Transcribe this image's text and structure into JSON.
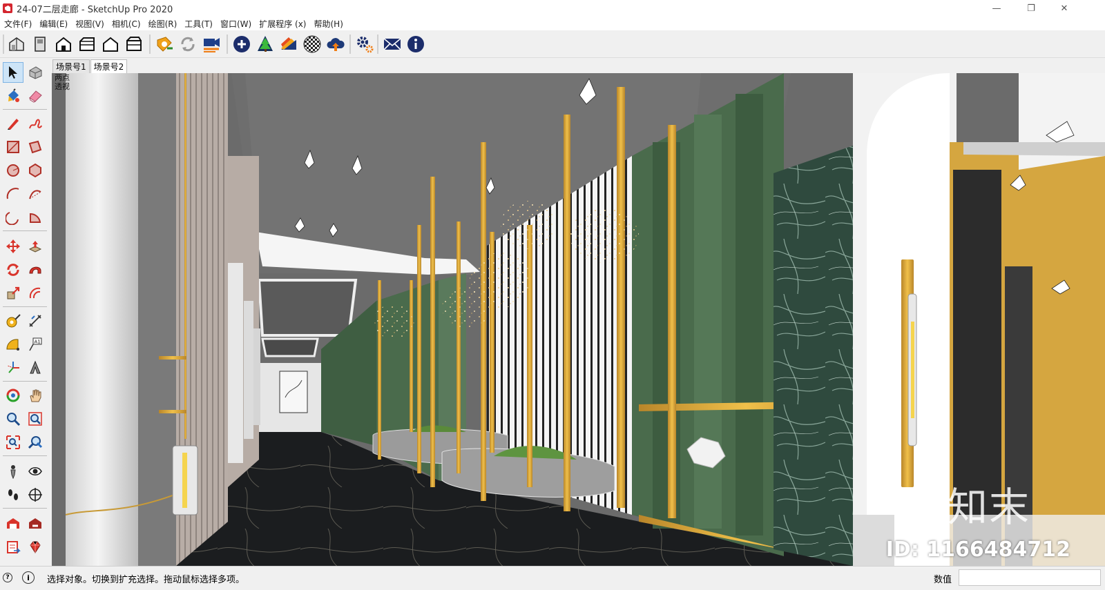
{
  "window": {
    "title": "24-07二层走廊 - SketchUp Pro 2020",
    "minimize": "—",
    "restore": "❐",
    "close": "✕"
  },
  "menu": [
    "文件(F)",
    "编辑(E)",
    "视图(V)",
    "相机(C)",
    "绘图(R)",
    "工具(T)",
    "窗口(W)",
    "扩展程序 (x)",
    "帮助(H)"
  ],
  "scene_tabs": [
    {
      "label": "场景号1",
      "active": false
    },
    {
      "label": "场景号2",
      "active": true
    }
  ],
  "viewport": {
    "label_line1": "两点",
    "label_line2": "透视"
  },
  "watermark": {
    "logo": "知末",
    "id": "ID: 1166484712"
  },
  "status": {
    "message": "选择对象。切换到扩充选择。拖动鼠标选择多项。",
    "value_label": "数值",
    "value": ""
  },
  "colors": {
    "accent_gold": "#d9a42f",
    "wall_green": "#4a6b4c",
    "marble_dark": "#2f4a3e",
    "floor": "#1b1d1f"
  }
}
